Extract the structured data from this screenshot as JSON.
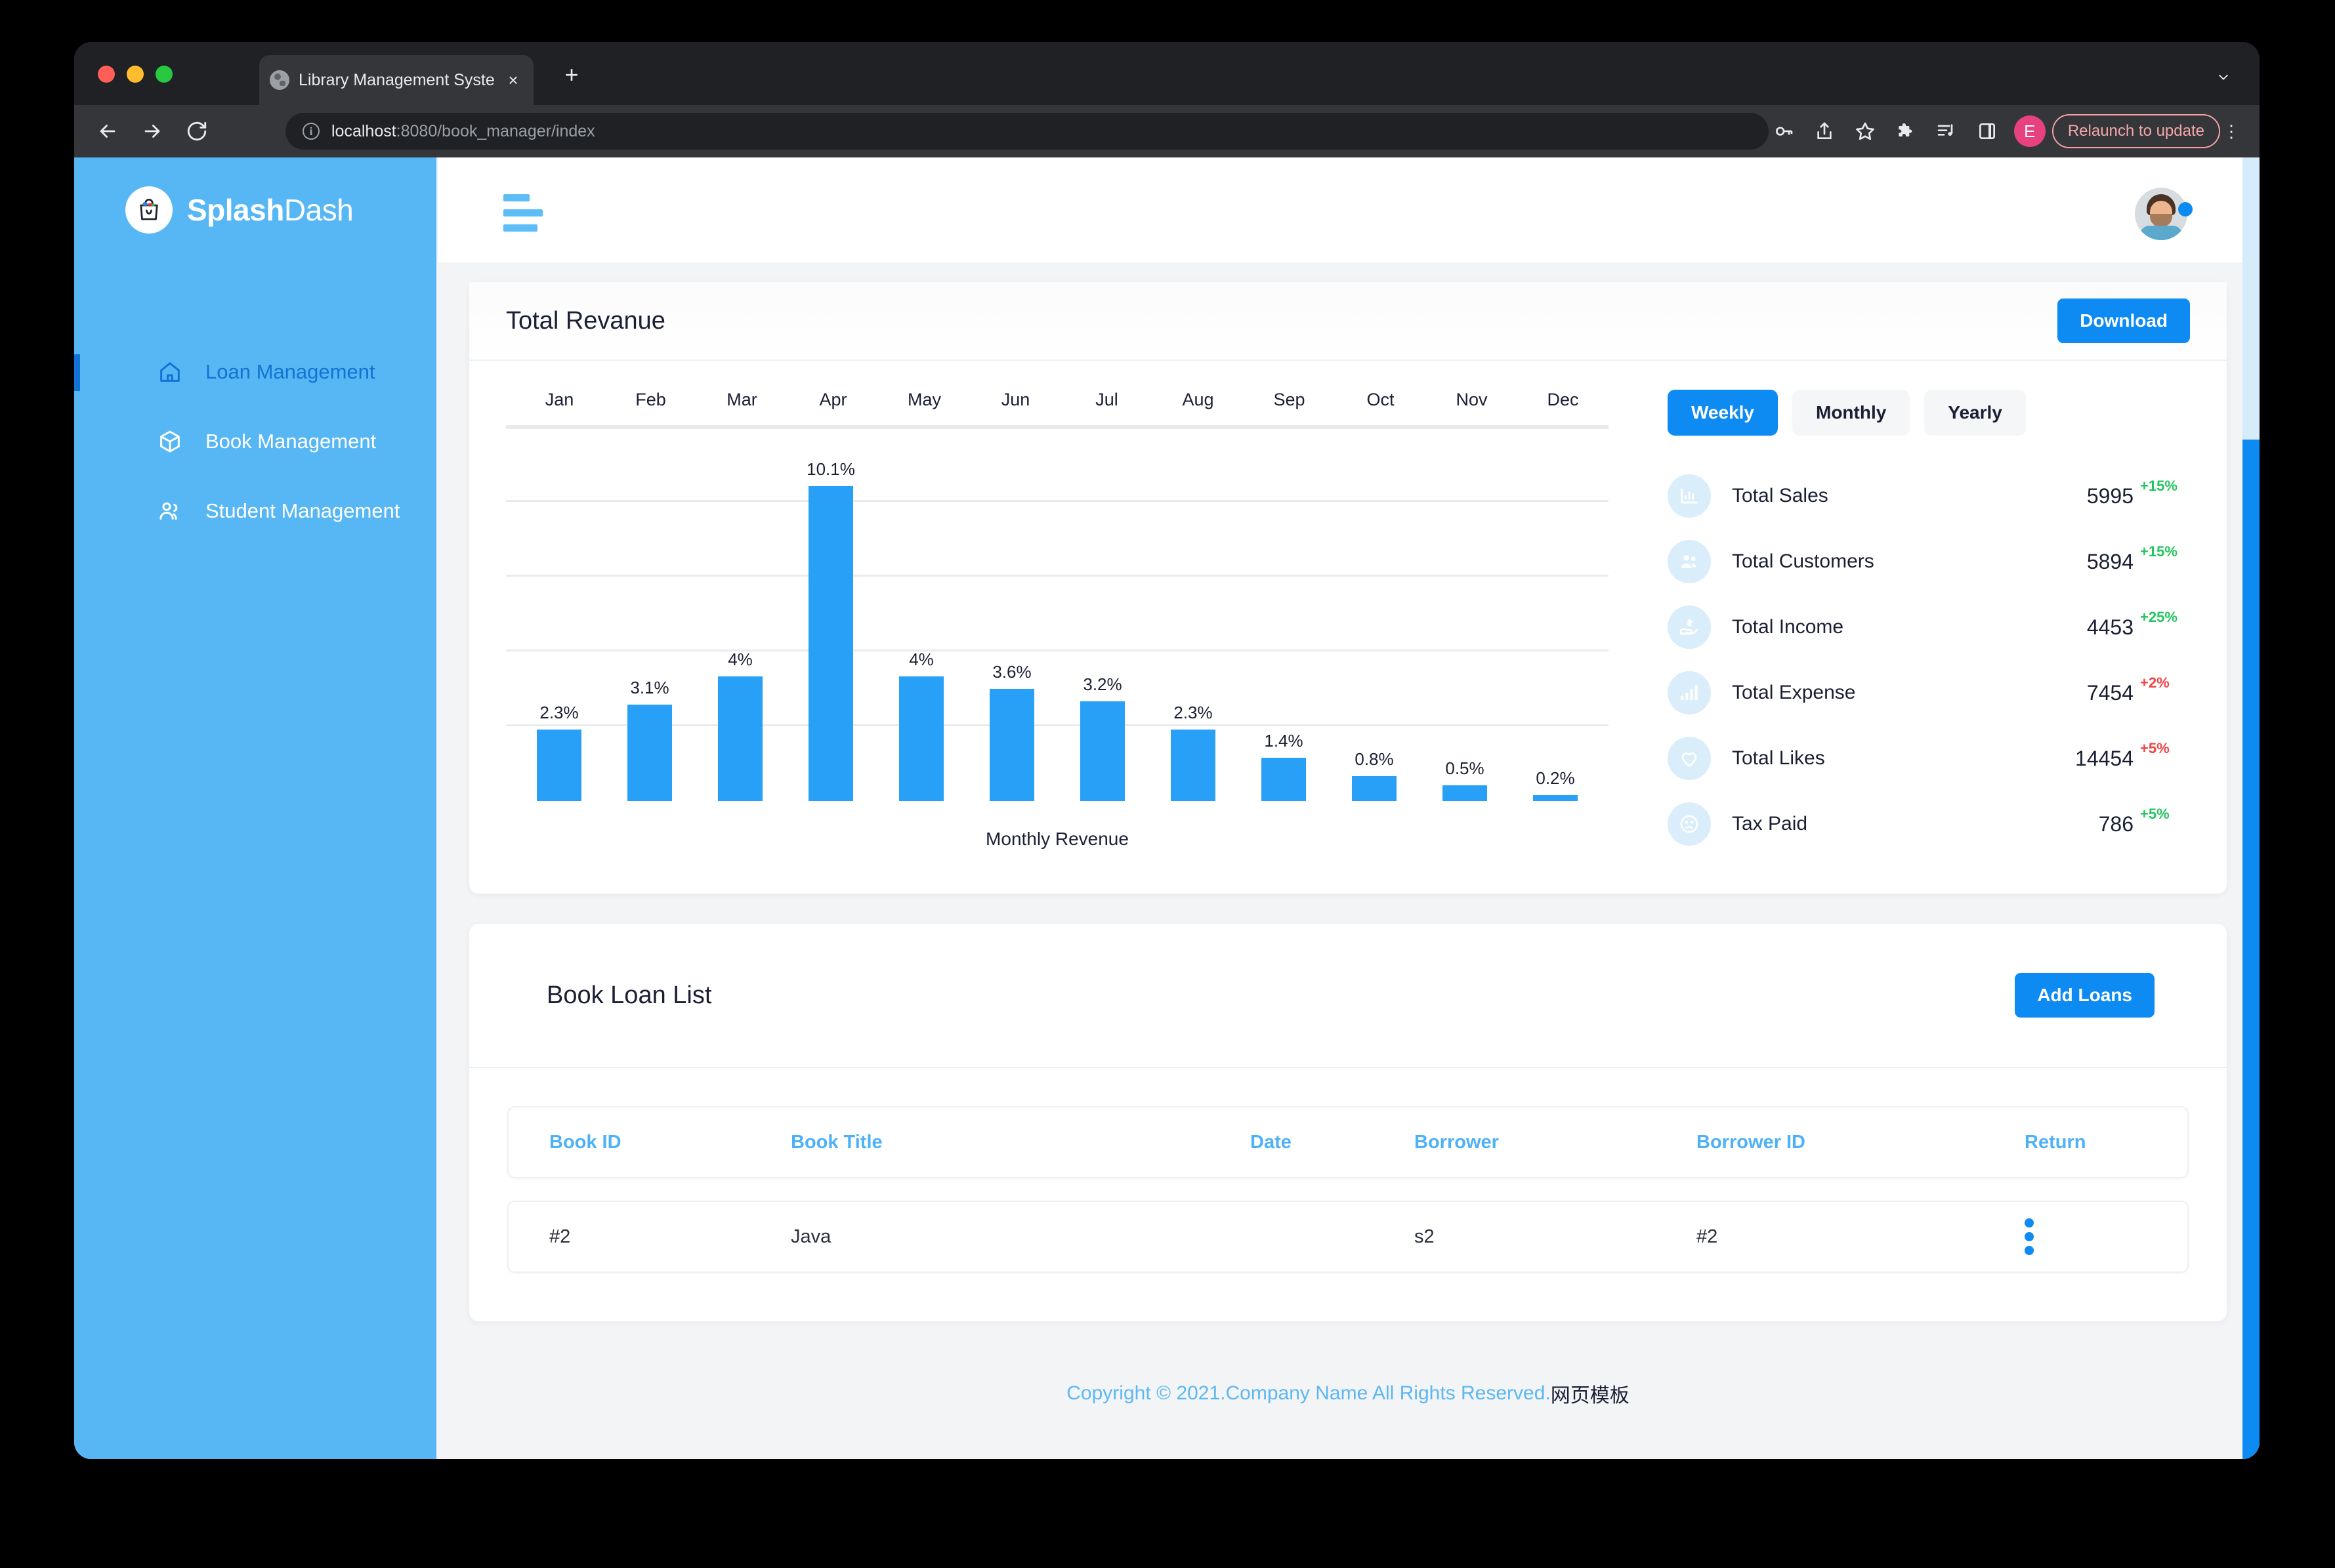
{
  "browser": {
    "tab_title": "Library Management System",
    "tab_close": "×",
    "new_tab": "+",
    "url_host": "localhost",
    "url_path": ":8080/book_manager/index",
    "profile_initial": "E",
    "relaunch_label": "Relaunch to update",
    "overflow": "⋮"
  },
  "sidebar": {
    "brand_bold": "Splash",
    "brand_light": "Dash",
    "items": [
      {
        "label": "Loan Management",
        "icon": "home-icon",
        "active": true
      },
      {
        "label": "Book Management",
        "icon": "box-icon",
        "active": false
      },
      {
        "label": "Student Management",
        "icon": "users-icon",
        "active": false
      }
    ]
  },
  "revenue": {
    "title": "Total Revanue",
    "download_label": "Download",
    "period_tabs": [
      {
        "label": "Weekly",
        "active": true
      },
      {
        "label": "Monthly",
        "active": false
      },
      {
        "label": "Yearly",
        "active": false
      }
    ],
    "stats": [
      {
        "icon": "bar-chart-icon",
        "label": "Total Sales",
        "value": "5995",
        "delta": "+15%",
        "dir": "up"
      },
      {
        "icon": "users-icon",
        "label": "Total Customers",
        "value": "5894",
        "delta": "+15%",
        "dir": "up"
      },
      {
        "icon": "hand-dollar-icon",
        "label": "Total Income",
        "value": "4453",
        "delta": "+25%",
        "dir": "up"
      },
      {
        "icon": "signal-bars-icon",
        "label": "Total Expense",
        "value": "7454",
        "delta": "+2%",
        "dir": "down"
      },
      {
        "icon": "heart-icon",
        "label": "Total Likes",
        "value": "14454",
        "delta": "+5%",
        "dir": "down"
      },
      {
        "icon": "sad-face-icon",
        "label": "Tax Paid",
        "value": "786",
        "delta": "+5%",
        "dir": "up"
      }
    ]
  },
  "chart_data": {
    "type": "bar",
    "title": "Total Revanue",
    "xlabel": "Monthly Revenue",
    "ylabel": "",
    "categories": [
      "Jan",
      "Feb",
      "Mar",
      "Apr",
      "May",
      "Jun",
      "Jul",
      "Aug",
      "Sep",
      "Oct",
      "Nov",
      "Dec"
    ],
    "values": [
      2.3,
      3.1,
      4,
      10.1,
      4,
      3.6,
      3.2,
      2.3,
      1.4,
      0.8,
      0.5,
      0.2
    ],
    "labels": [
      "2.3%",
      "3.1%",
      "4%",
      "10.1%",
      "4%",
      "3.6%",
      "3.2%",
      "2.3%",
      "1.4%",
      "0.8%",
      "0.5%",
      "0.2%"
    ],
    "ylim": [
      0,
      12
    ],
    "grid": true,
    "gridlines": [
      0,
      2.4,
      4.8,
      7.2,
      9.6,
      12
    ],
    "bar_color": "#29a0f8",
    "legend": null,
    "axis_labels_position": "top"
  },
  "loans": {
    "title": "Book Loan List",
    "add_label": "Add Loans",
    "columns": [
      "Book ID",
      "Book Title",
      "Date",
      "Borrower",
      "Borrower ID",
      "Return"
    ],
    "rows": [
      {
        "book_id": "#2",
        "book_title": "Java",
        "date": "",
        "borrower": "s2",
        "borrower_id": "#2",
        "return_menu": "kebab-icon"
      }
    ]
  },
  "footer": {
    "text": "Copyright © 2021.Company Name All Rights Reserved.",
    "cn": "网页模板"
  }
}
